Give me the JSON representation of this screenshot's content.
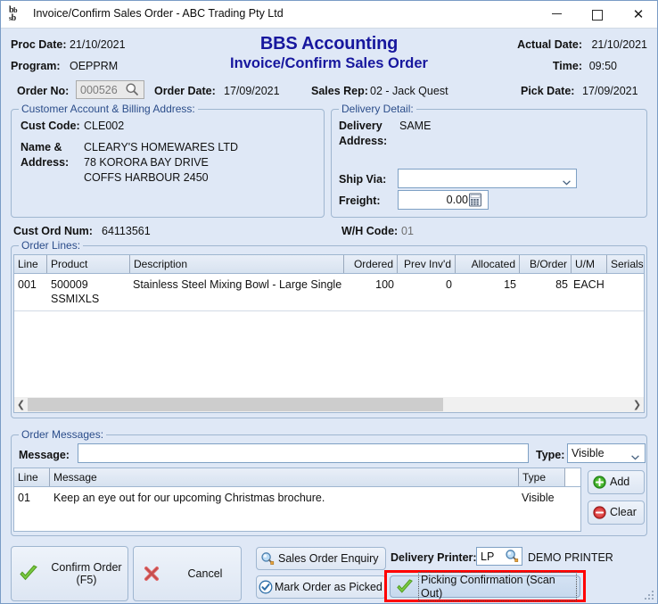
{
  "window": {
    "title": "Invoice/Confirm Sales Order - ABC Trading Pty Ltd",
    "icon": "bbs-logo-icon",
    "minimize_label": "–",
    "maximize_label": "☐",
    "close_label": "✕"
  },
  "header": {
    "proc_date_label": "Proc Date:",
    "proc_date_value": "21/10/2021",
    "program_label": "Program:",
    "program_value": "OEPPRM",
    "title_line1": "BBS Accounting",
    "title_line2": "Invoice/Confirm Sales Order",
    "actual_date_label": "Actual Date:",
    "actual_date_value": "21/10/2021",
    "time_label": "Time:",
    "time_value": "09:50",
    "order_no_label": "Order No:",
    "order_no_value": "000526",
    "order_no_search_icon": "magnifier-icon",
    "order_date_label": "Order Date:",
    "order_date_value": "17/09/2021",
    "sales_rep_label": "Sales Rep:",
    "sales_rep_value": "02 - Jack Quest",
    "pick_date_label": "Pick Date:",
    "pick_date_value": "17/09/2021"
  },
  "customer_panel": {
    "legend": "Customer Account & Billing Address:",
    "cust_code_label": "Cust Code:",
    "cust_code_value": "CLE002",
    "name_address_label_line1": "Name &",
    "name_address_label_line2": "Address:",
    "address_lines": [
      "CLEARY'S HOMEWARES LTD",
      "78 KORORA BAY DRIVE",
      "COFFS HARBOUR 2450"
    ]
  },
  "delivery_panel": {
    "legend": "Delivery Detail:",
    "delivery_address_label_line1": "Delivery",
    "delivery_address_label_line2": "Address:",
    "delivery_address_value": "SAME",
    "ship_via_label": "Ship Via:",
    "ship_via_value": "",
    "ship_via_chevron_icon": "chevron-down-icon",
    "freight_label": "Freight:",
    "freight_value": "0.00",
    "freight_calc_icon": "calculator-icon"
  },
  "order_info": {
    "cust_ord_num_label": "Cust Ord Num:",
    "cust_ord_num_value": "64113561",
    "wh_code_label": "W/H Code:",
    "wh_code_value": "01"
  },
  "order_lines": {
    "legend": "Order Lines:",
    "columns": [
      "Line",
      "Product",
      "Description",
      "Ordered",
      "Prev Inv'd",
      "Allocated",
      "B/Order",
      "U/M",
      "Serials"
    ],
    "rows": [
      {
        "line": "001",
        "product": "500009",
        "product_line2": "SSMIXLS",
        "description": "Stainless Steel Mixing Bowl - Large Single",
        "ordered": "100",
        "prev_invd": "0",
        "allocated": "15",
        "border": "85",
        "um": "EACH",
        "serials": ""
      }
    ],
    "scroll_left_icon": "chevron-left-icon",
    "scroll_right_icon": "chevron-right-icon"
  },
  "order_messages": {
    "legend": "Order Messages:",
    "message_label": "Message:",
    "message_value": "",
    "type_label": "Type:",
    "type_value": "Visible",
    "type_chevron_icon": "chevron-down-icon",
    "columns": [
      "Line",
      "Message",
      "Type"
    ],
    "rows": [
      {
        "line": "01",
        "message": "Keep an eye out for our upcoming Christmas brochure.",
        "type": "Visible"
      }
    ],
    "add_label": "Add",
    "add_icon": "plus-circle-icon",
    "clear_label": "Clear",
    "clear_icon": "minus-circle-icon"
  },
  "footer": {
    "confirm_label_line1": "Confirm Order",
    "confirm_label_line2": "(F5)",
    "confirm_icon": "green-check-icon",
    "cancel_label": "Cancel",
    "cancel_icon": "red-x-icon",
    "sales_order_enquiry_label": "Sales Order Enquiry",
    "sales_order_enquiry_icon": "magnifier-icon",
    "mark_order_picked_label": "Mark Order as Picked",
    "mark_order_picked_icon": "blue-check-circle-icon",
    "delivery_printer_label": "Delivery Printer:",
    "delivery_printer_value": "LP",
    "delivery_printer_search_icon": "magnifier-icon",
    "delivery_printer_name": "DEMO PRINTER",
    "picking_confirmation_label": "Picking Confirmation (Scan Out)",
    "picking_confirmation_icon": "green-check-icon"
  },
  "colors": {
    "window_background": "#dfe8f6",
    "title_text": "#17179e",
    "group_border": "#9fb6d0",
    "legend_text": "#2b4d8a",
    "highlight_box": "#ff0000",
    "field_border": "#7ea0c4"
  }
}
